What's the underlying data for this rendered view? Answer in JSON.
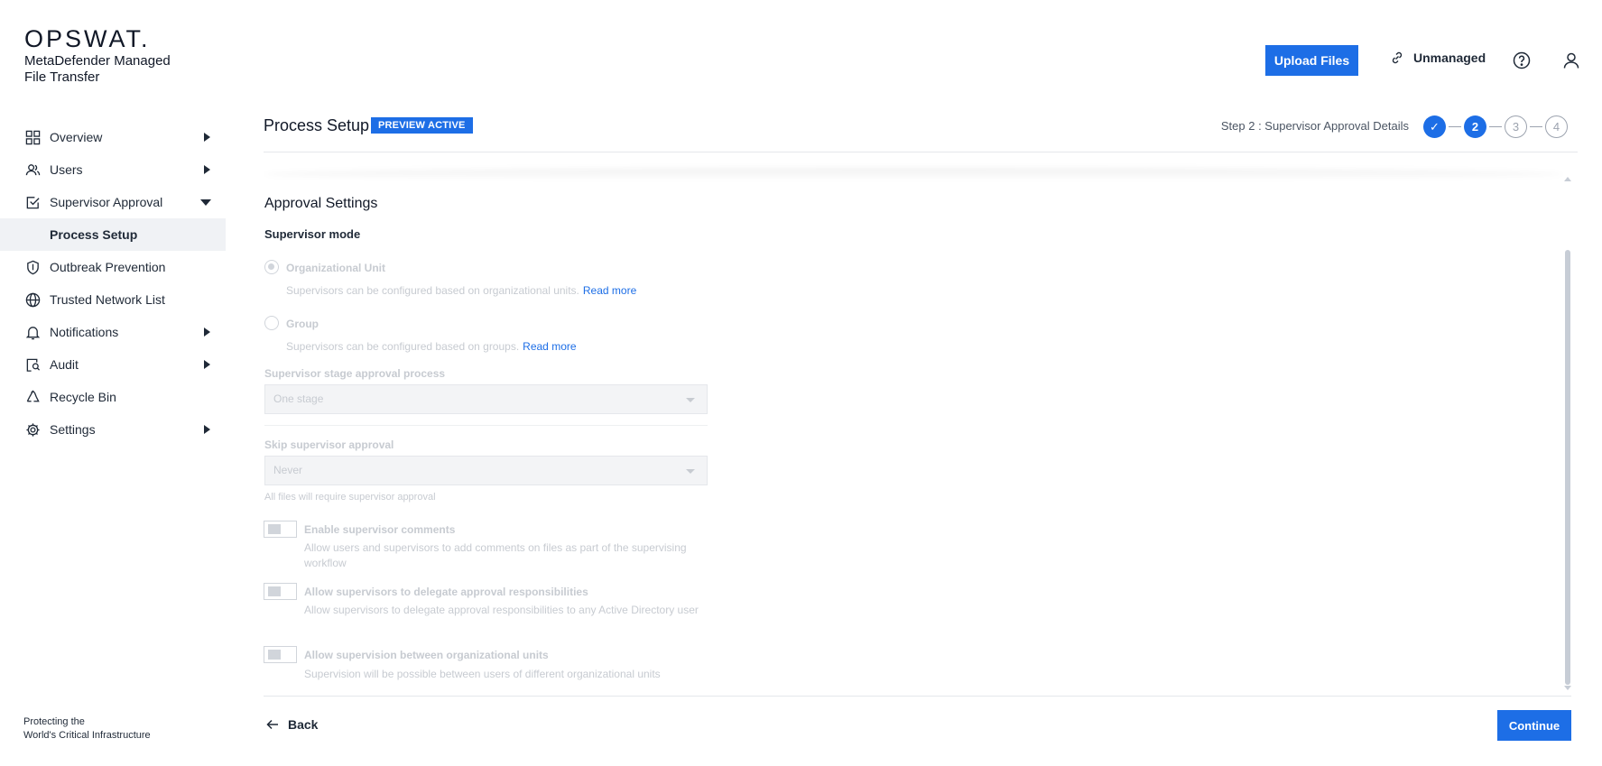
{
  "brand": {
    "logo": "OPSWAT.",
    "product": "MetaDefender Managed File Transfer",
    "tagline_line1": "Protecting the",
    "tagline_line2": "World's Critical Infrastructure"
  },
  "header": {
    "upload_label": "Upload Files",
    "unmanaged_label": "Unmanaged"
  },
  "sidebar": {
    "items": [
      {
        "label": "Overview",
        "icon": "grid-icon",
        "caret": "right"
      },
      {
        "label": "Users",
        "icon": "users-icon",
        "caret": "right"
      },
      {
        "label": "Supervisor Approval",
        "icon": "checkbox-icon",
        "caret": "down"
      },
      {
        "label": "Process Setup",
        "icon": "",
        "active": true
      },
      {
        "label": "Outbreak Prevention",
        "icon": "shield-icon"
      },
      {
        "label": "Trusted Network List",
        "icon": "globe-icon"
      },
      {
        "label": "Notifications",
        "icon": "bell-icon",
        "caret": "right"
      },
      {
        "label": "Audit",
        "icon": "audit-icon",
        "caret": "right"
      },
      {
        "label": "Recycle Bin",
        "icon": "recycle-icon"
      },
      {
        "label": "Settings",
        "icon": "gear-icon",
        "caret": "right"
      }
    ]
  },
  "page": {
    "title": "Process Setup",
    "badge": "PREVIEW ACTIVE",
    "step_label": "Step 2 : Supervisor Approval Details",
    "steps": [
      "✓",
      "2",
      "3",
      "4"
    ]
  },
  "settings": {
    "section_title": "Approval Settings",
    "supervisor_mode_label": "Supervisor mode",
    "org_unit": {
      "label": "Organizational Unit",
      "desc": "Supervisors can be configured based on organizational units.",
      "read_more": "Read more"
    },
    "group": {
      "label": "Group",
      "desc": "Supervisors can be configured based on groups.",
      "read_more": "Read more"
    },
    "stage_label": "Supervisor stage approval process",
    "stage_value": "One stage",
    "skip_label": "Skip supervisor approval",
    "skip_value": "Never",
    "skip_hint": "All files will require supervisor approval",
    "toggles": [
      {
        "label": "Enable supervisor comments",
        "desc": "Allow users and supervisors to add comments on files as part of the supervising workflow"
      },
      {
        "label": "Allow supervisors to delegate approval responsibilities",
        "desc": "Allow supervisors to delegate approval responsibilities to any Active Directory user"
      },
      {
        "label": "Allow supervision between organizational units",
        "desc": "Supervision will be possible between users of different organizational units"
      }
    ]
  },
  "footer": {
    "back_label": "Back",
    "continue_label": "Continue"
  },
  "colors": {
    "accent": "#1d6ee6",
    "disabled_text": "#c7cbd1"
  }
}
